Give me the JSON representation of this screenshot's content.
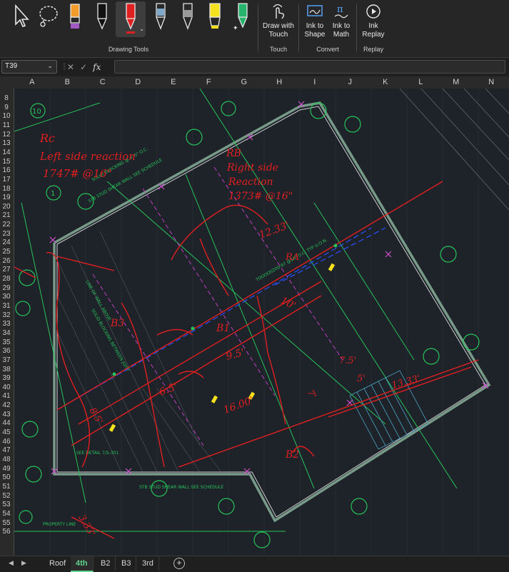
{
  "ribbon": {
    "groups": {
      "drawing_tools": "Drawing Tools",
      "touch": "Touch",
      "convert": "Convert",
      "replay": "Replay"
    },
    "buttons": {
      "draw_with_touch_1": "Draw with",
      "draw_with_touch_2": "Touch",
      "ink_to_shape_1": "Ink to",
      "ink_to_shape_2": "Shape",
      "ink_to_math_1": "Ink to",
      "ink_to_math_2": "Math",
      "ink_replay_1": "Ink",
      "ink_replay_2": "Replay"
    },
    "pens": [
      {
        "name": "select-icon"
      },
      {
        "name": "lasso-select-icon"
      },
      {
        "name": "orange-highlighter-pen",
        "color": "#f39c2a"
      },
      {
        "name": "black-pen",
        "color": "#111111"
      },
      {
        "name": "red-pen",
        "color": "#e02020"
      },
      {
        "name": "galaxy-pen",
        "color": "#7fa7c7"
      },
      {
        "name": "gray-pen",
        "color": "#9a9a9a"
      },
      {
        "name": "yellow-highlighter",
        "color": "#f5e11d"
      },
      {
        "name": "green-sparkle-pen",
        "color": "#26b36b"
      }
    ]
  },
  "formula_bar": {
    "name_box": "T39",
    "fx": "fx",
    "value": ""
  },
  "columns": [
    "A",
    "B",
    "C",
    "D",
    "E",
    "F",
    "G",
    "H",
    "I",
    "J",
    "K",
    "L",
    "M",
    "N"
  ],
  "rows": [
    "8",
    "9",
    "10",
    "11",
    "12",
    "13",
    "14",
    "15",
    "16",
    "17",
    "18",
    "19",
    "20",
    "21",
    "22",
    "23",
    "24",
    "25",
    "26",
    "27",
    "28",
    "29",
    "30",
    "31",
    "32",
    "33",
    "34",
    "35",
    "36",
    "37",
    "38",
    "39",
    "40",
    "41",
    "42",
    "43",
    "44",
    "45",
    "46",
    "47",
    "48",
    "49",
    "50",
    "51",
    "52",
    "53",
    "54",
    "55",
    "56"
  ],
  "sheet_tabs": [
    "Roof",
    "4th",
    "B2",
    "B3",
    "3rd"
  ],
  "active_tab": "4th",
  "annotations": {
    "rc": "Rc",
    "left_reaction": "Left side reaction",
    "left_value": "1747# @16\"",
    "rb": "RB",
    "right_side": "Right side",
    "reaction": "Reaction",
    "right_value": "1373# @16\"",
    "dim_12": "12.33'",
    "ra": "RA",
    "dim_10": "10'",
    "b1": "B1",
    "b3": "B3",
    "dim_95": "9.5'",
    "dim_75": "7.5'",
    "dim_5": "5'",
    "dim_133": "13.33'",
    "dim_65": "6.5'",
    "dim_1600": "16.00'",
    "dim_7": "7'",
    "b2": "B2",
    "dim_333": "3.33'",
    "dim_85": "8.5'"
  },
  "drawing_labels": {
    "grid_10": "10",
    "grid_1": "1",
    "shear_wall_top": "STB STUD SHEAR WALL SEE SCHEDULE",
    "solid_blocking": "SOLID BLOCKING @ 4'-0\" O.C.",
    "line_of_wall": "LINE OF WALL ABOVE",
    "solid_blocking_joist": "SOLID BLOCKING BETWEEN JOIST",
    "see_detail": "SEE DETAIL 7/S-301",
    "shear_wall_bottom": "STB STUD SHEAR WALL SEE SCHEDULE",
    "property_line": "PROPERTY LINE",
    "joist_note": "TOOOOS200-97 @16\" O.C. TYP U.O.N."
  }
}
